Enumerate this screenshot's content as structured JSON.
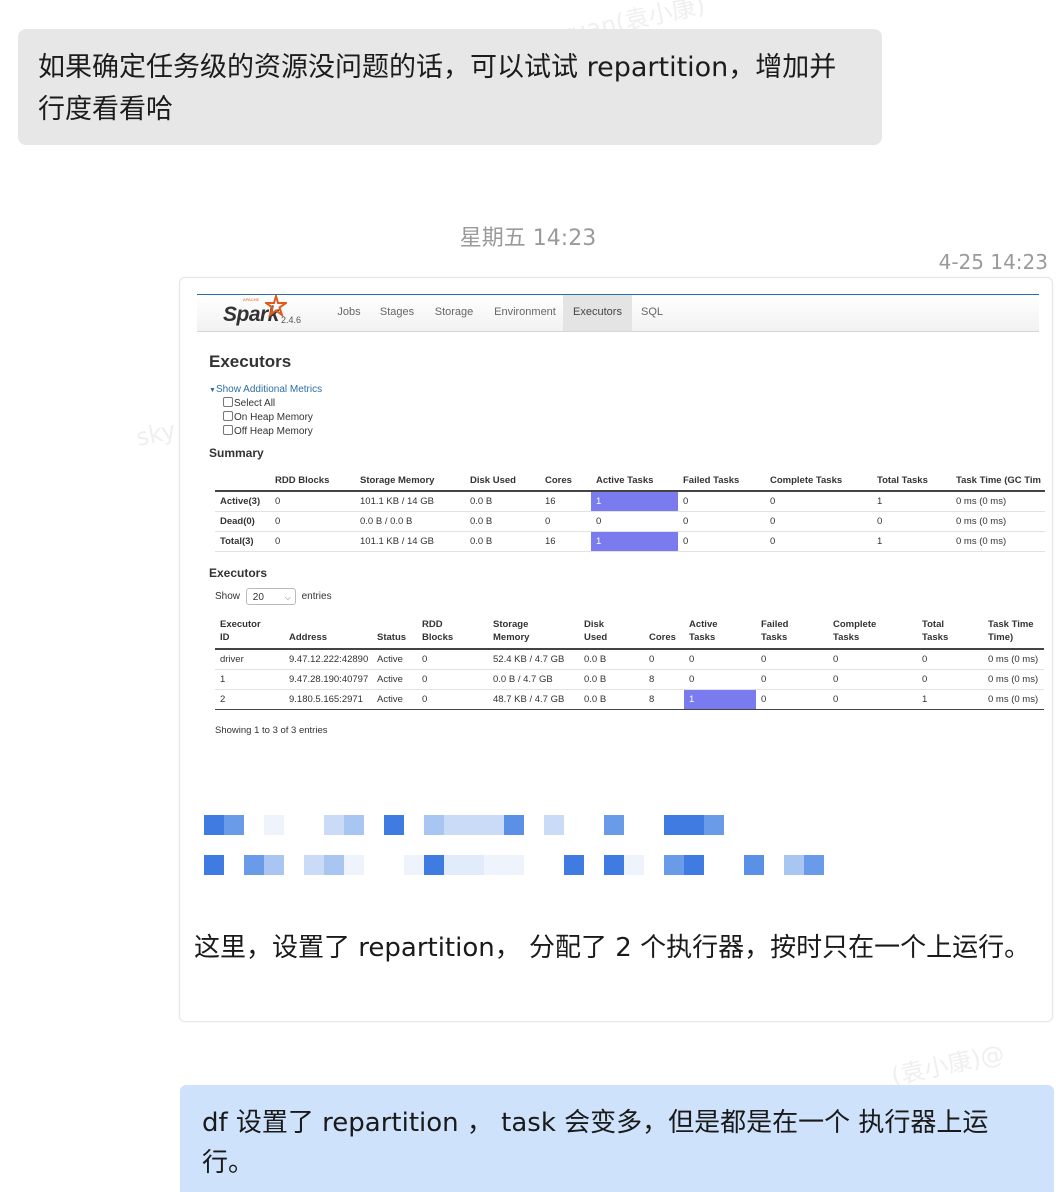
{
  "messages": {
    "top": "如果确定任务级的资源没问题的话，可以试试 repartition，增加并行度看看哈",
    "day_time": "星期五 14:23",
    "card_time": "4-25 14:23",
    "card_caption": "这里，设置了 repartition， 分配了 2 个执行器，按时只在一个上运行。",
    "bottom": "df 设置了 repartition ， task 会变多，但是都是在一个 执行器上运行。"
  },
  "spark": {
    "brand": "Spark",
    "version": "2.4.6",
    "tabs": [
      "Jobs",
      "Stages",
      "Storage",
      "Environment",
      "Executors",
      "SQL"
    ],
    "active_tab": "Executors",
    "title": "Executors",
    "metrics_link": "Show Additional Metrics",
    "metric_options": [
      "Select All",
      "On Heap Memory",
      "Off Heap Memory"
    ],
    "summary_title": "Summary",
    "summary_headers": [
      "",
      "RDD Blocks",
      "Storage Memory",
      "Disk Used",
      "Cores",
      "Active Tasks",
      "Failed Tasks",
      "Complete Tasks",
      "Total Tasks",
      "Task Time (GC Tim"
    ],
    "summary_rows": [
      [
        "Active(3)",
        "0",
        "101.1 KB / 14 GB",
        "0.0 B",
        "16",
        "1",
        "0",
        "0",
        "1",
        "0 ms (0 ms)"
      ],
      [
        "Dead(0)",
        "0",
        "0.0 B / 0.0 B",
        "0.0 B",
        "0",
        "0",
        "0",
        "0",
        "0",
        "0 ms (0 ms)"
      ],
      [
        "Total(3)",
        "0",
        "101.1 KB / 14 GB",
        "0.0 B",
        "16",
        "1",
        "0",
        "0",
        "1",
        "0 ms (0 ms)"
      ]
    ],
    "executors_title": "Executors",
    "show_label": "Show",
    "show_value": "20",
    "entries_label": "entries",
    "executor_headers": [
      [
        "Executor",
        "ID"
      ],
      [
        "",
        "Address"
      ],
      [
        "",
        "Status"
      ],
      [
        "RDD",
        "Blocks"
      ],
      [
        "Storage",
        "Memory"
      ],
      [
        "Disk",
        "Used"
      ],
      [
        "",
        "Cores"
      ],
      [
        "Active",
        "Tasks"
      ],
      [
        "Failed",
        "Tasks"
      ],
      [
        "Complete",
        "Tasks"
      ],
      [
        "Total",
        "Tasks"
      ],
      [
        "Task Time",
        "Time)"
      ]
    ],
    "executor_rows": [
      [
        "driver",
        "9.47.12.222:42890",
        "Active",
        "0",
        "52.4 KB / 4.7 GB",
        "0.0 B",
        "0",
        "0",
        "0",
        "0",
        "0",
        "0 ms (0 ms)"
      ],
      [
        "1",
        "9.47.28.190:40797",
        "Active",
        "0",
        "0.0 B / 4.7 GB",
        "0.0 B",
        "8",
        "0",
        "0",
        "0",
        "0",
        "0 ms (0 ms)"
      ],
      [
        "2",
        "9.180.5.165:2971",
        "Active",
        "0",
        "48.7 KB / 4.7 GB",
        "0.0 B",
        "8",
        "1",
        "0",
        "0",
        "1",
        "0 ms (0 ms)"
      ]
    ],
    "showing_text": "Showing 1 to 3 of 3 entries"
  },
  "colors": {
    "top_bubble": "#e7e7e7",
    "bottom_bubble": "#cfe2fb",
    "active_task_bar": "#7b7bf0",
    "mosaic_blue": "#3f7be0"
  }
}
